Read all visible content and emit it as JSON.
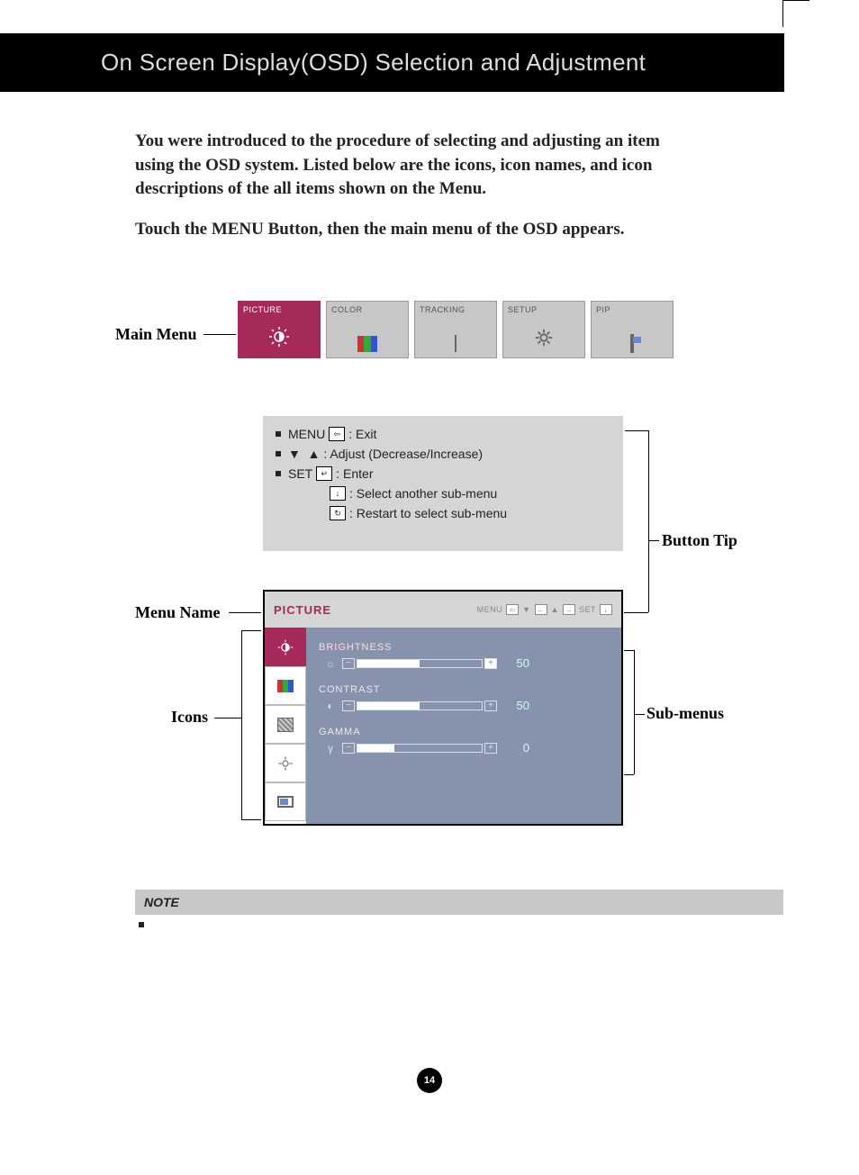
{
  "header": {
    "title": "On Screen Display(OSD) Selection and Adjustment"
  },
  "intro": {
    "p1": "You were introduced to the procedure of selecting and adjusting an item using the OSD system.  Listed below are the icons, icon names, and icon descriptions of the all items shown on the Menu.",
    "p2": "Touch the MENU Button, then the main menu of the OSD appears."
  },
  "callouts": {
    "main_menu": "Main Menu",
    "button_tip": "Button Tip",
    "menu_name": "Menu Name",
    "icons": "Icons",
    "sub_menus": "Sub-menus"
  },
  "tabs": [
    {
      "label": "PICTURE",
      "active": true,
      "icon": "brightness"
    },
    {
      "label": "COLOR",
      "active": false,
      "icon": "color"
    },
    {
      "label": "TRACKING",
      "active": false,
      "icon": "tracking"
    },
    {
      "label": "SETUP",
      "active": false,
      "icon": "gear"
    },
    {
      "label": "PIP",
      "active": false,
      "icon": "pip"
    }
  ],
  "tips": {
    "menu_label": "MENU",
    "menu_desc": ": Exit",
    "adjust_desc": ": Adjust (Decrease/Increase)",
    "set_label": "SET",
    "set_desc": ": Enter",
    "select_desc": ": Select another sub-menu",
    "restart_desc": ": Restart to select sub-menu"
  },
  "osd": {
    "title": "PICTURE",
    "head_menu": "MENU",
    "head_set": "SET",
    "items": [
      {
        "label": "BRIGHTNESS",
        "value": 50,
        "fill": 50,
        "active": true,
        "glyph": "☼"
      },
      {
        "label": "CONTRAST",
        "value": 50,
        "fill": 50,
        "active": false,
        "glyph": "◐"
      },
      {
        "label": "GAMMA",
        "value": 0,
        "fill": 30,
        "active": false,
        "glyph": "γ"
      }
    ]
  },
  "note": {
    "label": "NOTE"
  },
  "page_number": "14"
}
